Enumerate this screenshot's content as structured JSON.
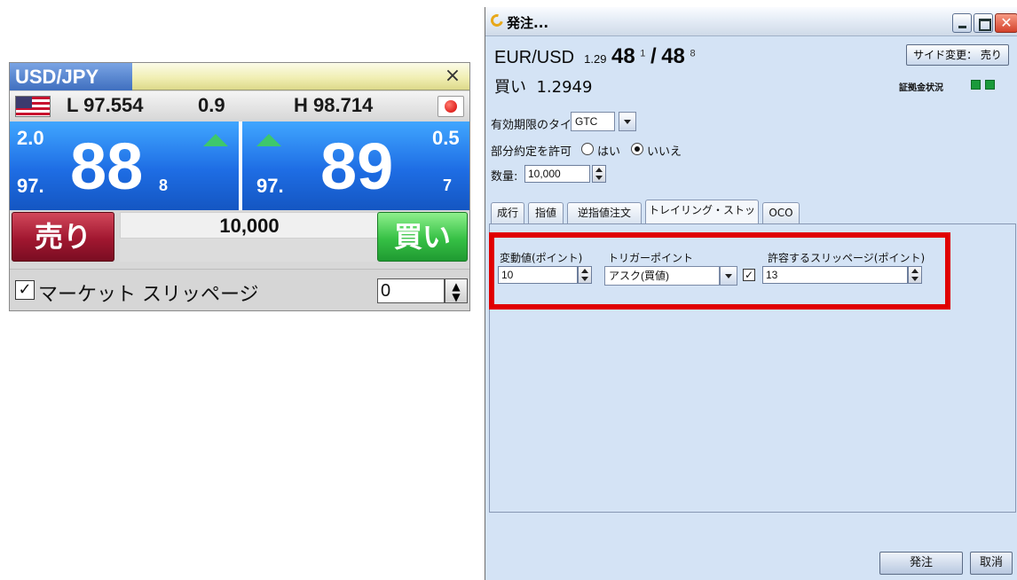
{
  "rate_panel": {
    "pair": "USD/JPY",
    "close_symbol": "×",
    "low": "L 97.554",
    "spread": "0.9",
    "high": "H 98.714",
    "sell": {
      "pips_change": "2.0",
      "prefix": "97.",
      "big": "88",
      "sup": "8"
    },
    "buy": {
      "pips_change": "0.5",
      "prefix": "97.",
      "big": "89",
      "sup": "7"
    },
    "sell_label": "売り",
    "buy_label": "買い",
    "amount": "10,000",
    "market_slippage_label": "マーケット スリッページ",
    "market_slippage_checked": true,
    "market_slippage_value": "0",
    "colors": {
      "bid_ask_blue": "#1e6de4",
      "sell_red": "#a11730",
      "buy_green": "#36c045",
      "trend_up": "#3ec86b"
    }
  },
  "order_dialog": {
    "title": "発注...",
    "pair": "EUR/USD",
    "price_prefix": "1.29",
    "bid": "48",
    "bid_sup": "1",
    "separator": "/",
    "ask": "48",
    "ask_sup": "8",
    "side_change_label": "サイド変更： 売り",
    "side": "買い",
    "side_price": "1.2949",
    "margin_status_label": "証拠金状況",
    "expiry_label": "有効期限のタイプ:",
    "expiry_value": "GTC",
    "partial_fill_label": "部分約定を許可",
    "partial_fill_yes": "はい",
    "partial_fill_no": "いいえ",
    "partial_fill_selected": "いいえ",
    "quantity_label": "数量:",
    "quantity_value": "10,000",
    "tabs": [
      {
        "label": "成行"
      },
      {
        "label": "指値"
      },
      {
        "label": "逆指値注文"
      },
      {
        "label": "トレイリング・ストップ"
      },
      {
        "label": "OCO"
      }
    ],
    "active_tab": "トレイリング・ストップ",
    "trailing": {
      "variation_label": "変動値(ポイント)",
      "variation_value": "10",
      "trigger_label": "トリガーポイント",
      "trigger_value": "アスク(買値)",
      "slippage_label": "許容するスリッページ(ポイント)",
      "slippage_checked": true,
      "slippage_value": "13"
    },
    "submit_label": "発注",
    "cancel_label": "取消",
    "colors": {
      "highlight_red": "#e00000",
      "panel_bg": "#d4e3f5"
    }
  }
}
